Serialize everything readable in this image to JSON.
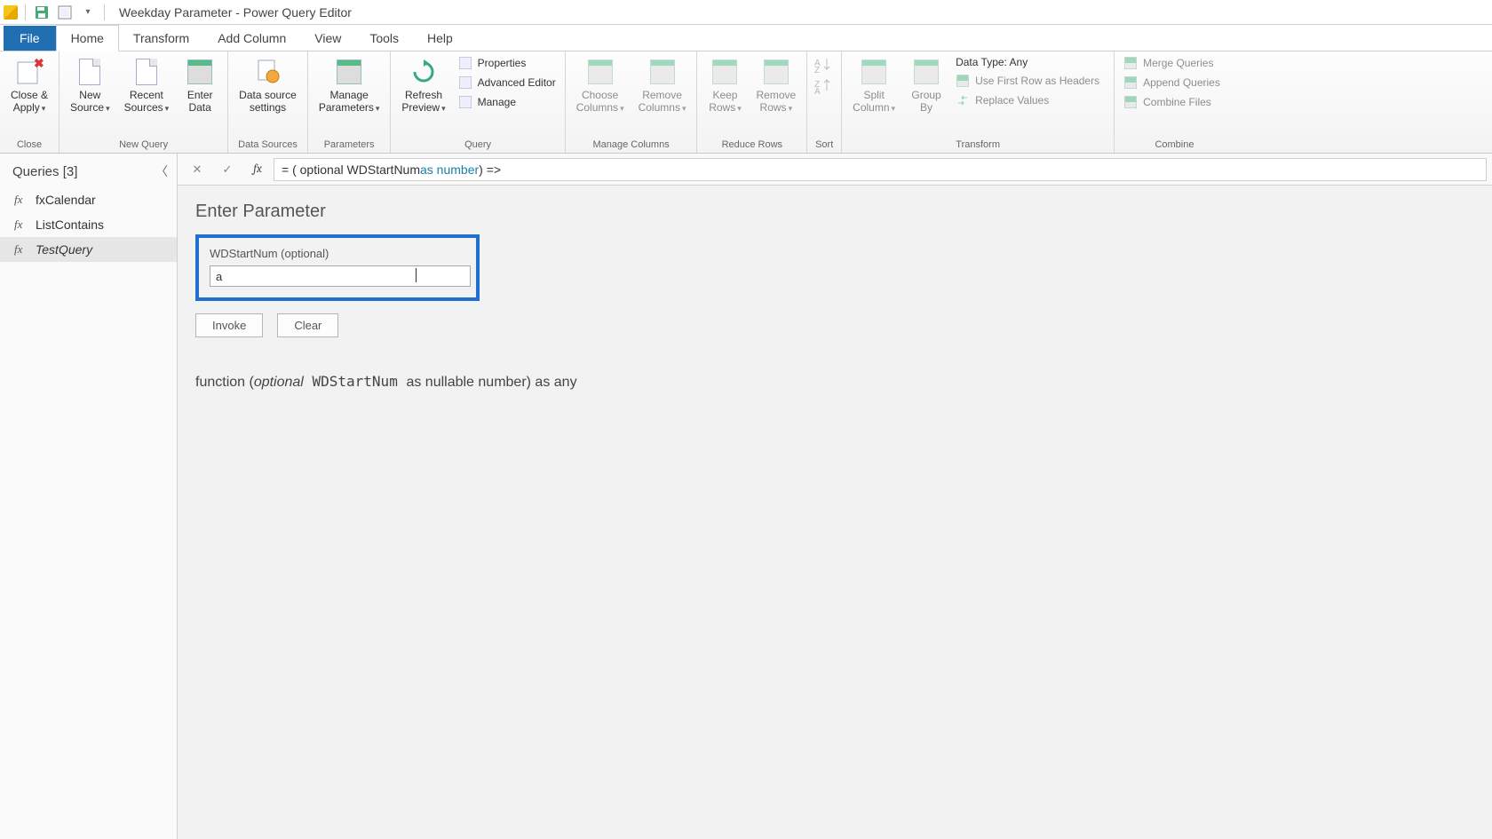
{
  "window": {
    "title": "Weekday Parameter - Power Query Editor"
  },
  "menu": {
    "file": "File",
    "home": "Home",
    "transform": "Transform",
    "addcolumn": "Add Column",
    "view": "View",
    "tools": "Tools",
    "help": "Help"
  },
  "ribbon": {
    "close": {
      "closeapply": "Close &\nApply",
      "group": "Close"
    },
    "new": {
      "newsource": "New\nSource",
      "recentsources": "Recent\nSources",
      "enterdata": "Enter\nData",
      "group": "New Query"
    },
    "datasources": {
      "settings": "Data source\nsettings",
      "group": "Data Sources"
    },
    "parameters": {
      "manage": "Manage\nParameters",
      "group": "Parameters"
    },
    "query": {
      "refresh": "Refresh\nPreview",
      "properties": "Properties",
      "advanced": "Advanced Editor",
      "manage": "Manage",
      "group": "Query"
    },
    "managecols": {
      "choose": "Choose\nColumns",
      "remove": "Remove\nColumns",
      "group": "Manage Columns"
    },
    "reducerows": {
      "keep": "Keep\nRows",
      "remove": "Remove\nRows",
      "group": "Reduce Rows"
    },
    "sort": {
      "group": "Sort"
    },
    "transform": {
      "split": "Split\nColumn",
      "groupby": "Group\nBy",
      "datatype": "Data Type: Any",
      "firstrow": "Use First Row as Headers",
      "replace": "Replace Values",
      "group": "Transform"
    },
    "combine": {
      "merge": "Merge Queries",
      "append": "Append Queries",
      "combine": "Combine Files",
      "group": "Combine"
    }
  },
  "queries": {
    "header": "Queries [3]",
    "items": [
      {
        "name": "fxCalendar"
      },
      {
        "name": "ListContains"
      },
      {
        "name": "TestQuery"
      }
    ]
  },
  "formula": {
    "prefix": "= ( optional WDStartNum ",
    "kw": "as number",
    "suffix": ") =>"
  },
  "param": {
    "section": "Enter Parameter",
    "label": "WDStartNum (optional)",
    "value": "a",
    "invoke": "Invoke",
    "clear": "Clear"
  },
  "signature": {
    "p1": "function (",
    "ital": "optional",
    "mono": " WDStartNum ",
    "p2": "as nullable number) as any"
  }
}
